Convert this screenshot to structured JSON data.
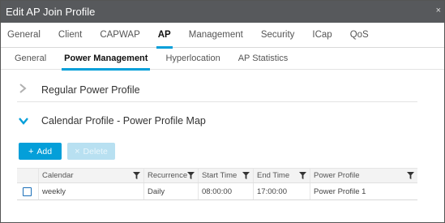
{
  "dialog": {
    "title": "Edit AP Join Profile",
    "close_label": "×"
  },
  "main_tabs": [
    "General",
    "Client",
    "CAPWAP",
    "AP",
    "Management",
    "Security",
    "ICap",
    "QoS"
  ],
  "sub_tabs": [
    "General",
    "Power Management",
    "Hyperlocation",
    "AP Statistics"
  ],
  "sections": {
    "regular": {
      "title": "Regular Power Profile",
      "expanded": false
    },
    "calendar": {
      "title": "Calendar Profile - Power Profile Map",
      "expanded": true
    }
  },
  "toolbar": {
    "add_label": "Add",
    "delete_label": "Delete",
    "add_icon": "+",
    "delete_icon": "×"
  },
  "table": {
    "columns": [
      "Calendar",
      "Recurrence",
      "Start Time",
      "End Time",
      "Power Profile"
    ],
    "rows": [
      {
        "calendar": "weekly",
        "recurrence": "Daily",
        "start": "08:00:00",
        "end": "17:00:00",
        "power_profile": "Power Profile 1"
      }
    ]
  },
  "colors": {
    "accent": "#049fd9",
    "titlebar": "#57595c"
  }
}
